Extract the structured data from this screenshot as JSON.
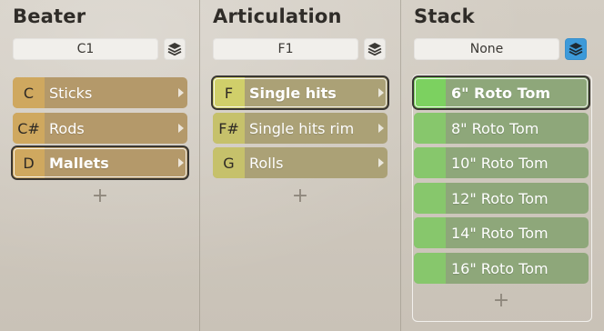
{
  "beater": {
    "title": "Beater",
    "selector_value": "C1",
    "items": [
      {
        "key": "C",
        "label": "Sticks"
      },
      {
        "key": "C#",
        "label": "Rods"
      },
      {
        "key": "D",
        "label": "Mallets"
      }
    ],
    "add_label": "+"
  },
  "articulation": {
    "title": "Articulation",
    "selector_value": "F1",
    "items": [
      {
        "key": "F",
        "label": "Single hits"
      },
      {
        "key": "F#",
        "label": "Single hits rim"
      },
      {
        "key": "G",
        "label": "Rolls"
      }
    ],
    "add_label": "+"
  },
  "stack": {
    "title": "Stack",
    "selector_value": "None",
    "items": [
      {
        "label": "6\" Roto Tom"
      },
      {
        "label": "8\" Roto Tom"
      },
      {
        "label": "10\" Roto Tom"
      },
      {
        "label": "12\" Roto Tom"
      },
      {
        "label": "14\" Roto Tom"
      },
      {
        "label": "16\" Roto Tom"
      }
    ],
    "add_label": "+"
  },
  "icons": {
    "layers": "layers-icon",
    "submenu_arrow": "chevron-right-icon",
    "add": "plus-icon"
  },
  "colors": {
    "beater_key": "#cfa85f",
    "beater_body": "#b4996a",
    "articulation_key": "#c6c16b",
    "articulation_body": "#aba176",
    "stack_key": "#87c76c",
    "stack_body": "#8ea77a",
    "layer_button_active": "#3d9ad9"
  }
}
